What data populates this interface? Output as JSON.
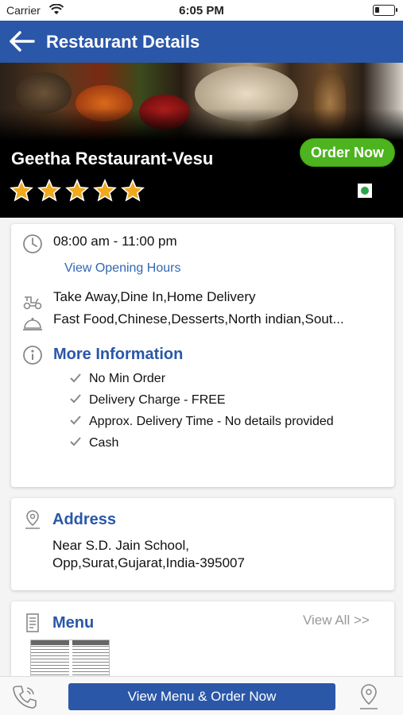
{
  "status_bar": {
    "carrier": "Carrier",
    "time": "6:05 PM"
  },
  "nav": {
    "title": "Restaurant Details"
  },
  "hero": {
    "restaurant_name": "Geetha Restaurant-Vesu",
    "order_button": "Order Now",
    "rating_stars": 5
  },
  "info": {
    "hours": "08:00 am - 11:00 pm",
    "view_hours_link": "View Opening Hours",
    "services": "Take Away,Dine In,Home Delivery",
    "cuisines": "Fast Food,Chinese,Desserts,North indian,Sout...",
    "more_info_title": "More Information",
    "details": [
      "No Min Order",
      "Delivery Charge - FREE",
      "Approx. Delivery Time - No details provided",
      "Cash"
    ]
  },
  "address": {
    "title": "Address",
    "line1": "Near S.D. Jain School,",
    "line2": "Opp,Surat,Gujarat,India-395007"
  },
  "menu": {
    "title": "Menu",
    "view_all": "View All >>"
  },
  "bottom_bar": {
    "view_menu_button": "View Menu & Order Now"
  },
  "colors": {
    "primary": "#2a57a8",
    "order_green": "#4db31f",
    "star_gold": "#f0a81c",
    "link_blue": "#3367b0"
  }
}
